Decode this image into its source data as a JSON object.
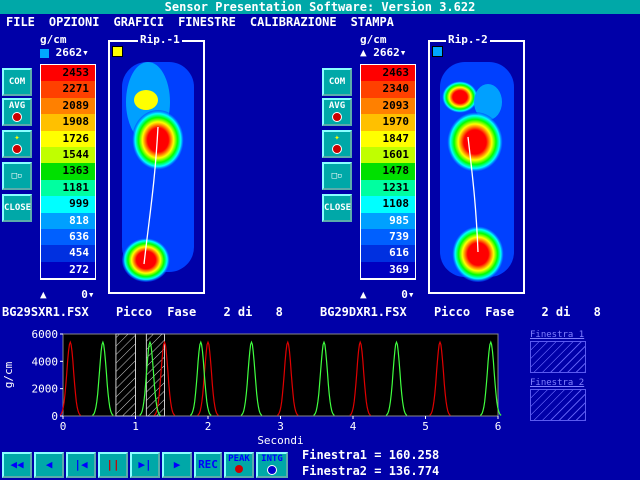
{
  "title": "Sensor Presentation Software:  Version  3.622",
  "menu": [
    "FILE",
    "OPZIONI",
    "GRAFICI",
    "FINESTRE",
    "CALIBRAZIONE",
    "STAMPA"
  ],
  "unit": "g/cm",
  "left": {
    "max_value": "2662",
    "frame_title": "Rip.-1",
    "scale": [
      "2453",
      "2271",
      "2089",
      "1908",
      "1726",
      "1544",
      "1363",
      "1181",
      "999",
      "818",
      "636",
      "454",
      "272"
    ],
    "zero": "0",
    "filename": "BG29SXR1.FSX",
    "picco": "Picco",
    "fase": "Fase",
    "fase_num": "2",
    "di": "di",
    "fase_total": "8"
  },
  "right": {
    "max_value": "2662",
    "frame_title": "Rip.-2",
    "scale": [
      "2463",
      "2340",
      "2093",
      "1970",
      "1847",
      "1601",
      "1478",
      "1231",
      "1108",
      "985",
      "739",
      "616",
      "369"
    ],
    "zero": "0",
    "filename": "BG29DXR1.FSX",
    "picco": "Picco",
    "fase": "Fase",
    "fase_num": "2",
    "di": "di",
    "fase_total": "8"
  },
  "side_buttons": [
    "COM",
    "AVG",
    "",
    "",
    "CLOSE"
  ],
  "colors": {
    "scale": [
      "#ff0000",
      "#ff4000",
      "#ff8000",
      "#ffc000",
      "#ffff00",
      "#c0ff00",
      "#00e000",
      "#00ffa0",
      "#00ffff",
      "#00a0ff",
      "#0060ff",
      "#0030e0",
      "#0000c0"
    ],
    "series_red": "#e00000",
    "series_green": "#40ff40",
    "background": "#0000a8"
  },
  "chart_data": {
    "type": "line",
    "xlabel": "Secondi",
    "ylabel": "g/cm",
    "xlim": [
      0,
      6
    ],
    "ylim": [
      0,
      6000
    ],
    "xticks": [
      "0",
      "1",
      "2",
      "3",
      "4",
      "5",
      "6"
    ],
    "yticks": [
      "0",
      "2000",
      "4000",
      "6000"
    ],
    "series": [
      {
        "color": "red",
        "peaks": [
          0.1,
          1.4,
          2.0,
          3.1,
          4.1,
          5.2
        ]
      },
      {
        "color": "green",
        "peaks": [
          0.55,
          1.2,
          1.9,
          2.6,
          3.6,
          4.6,
          5.9
        ]
      }
    ],
    "peak_value": 5400,
    "window1": [
      0.73,
      1.0
    ],
    "window2": [
      1.15,
      1.4
    ]
  },
  "windows": {
    "finestra1_label": "Finestra 1",
    "finestra2_label": "Finestra 2"
  },
  "toolbar": {
    "buttons": [
      "◀◀",
      "◀",
      "|◀",
      "||",
      "▶|",
      "▶",
      "REC",
      "PEAK",
      "INTG"
    ]
  },
  "status": {
    "finestra1": "Finestra1 = 160.258",
    "finestra2": "Finestra2 = 136.774"
  }
}
